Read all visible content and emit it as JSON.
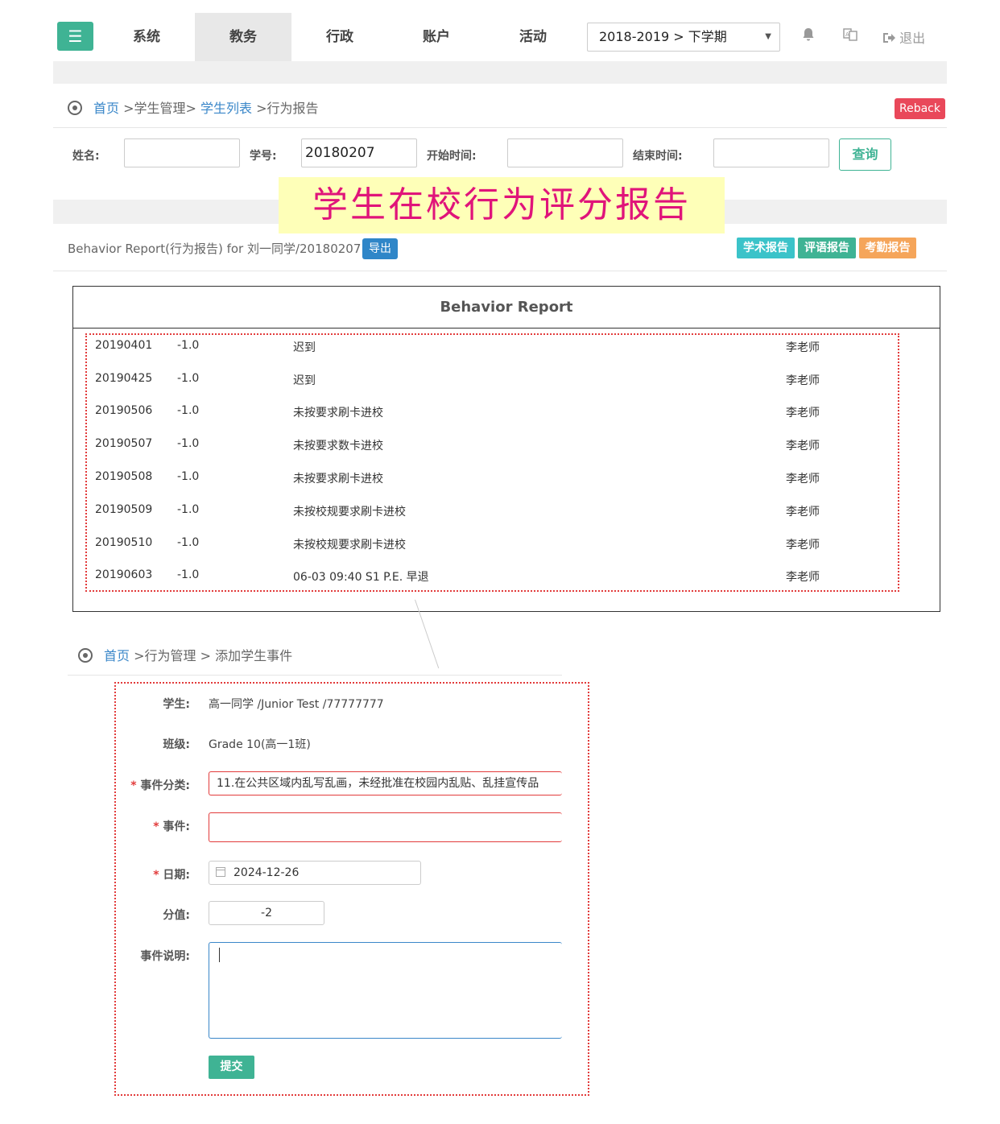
{
  "nav": {
    "menu_icon": "menu-icon",
    "items": [
      {
        "label": "系统"
      },
      {
        "label": "教务"
      },
      {
        "label": "行政"
      },
      {
        "label": "账户"
      },
      {
        "label": "活动"
      }
    ],
    "active_index": 1,
    "term": "2018-2019 > 下学期",
    "icons": [
      "bell-icon",
      "translate-icon",
      "logout-icon"
    ],
    "logout_label": "退出"
  },
  "breadcrumb1": {
    "home": "首页",
    "sep1": " >学生管理> ",
    "list": "学生列表",
    "sep2": " >行为报告"
  },
  "reback_label": "Reback",
  "search": {
    "name_label": "姓名:",
    "name_value": "",
    "id_label": "学号:",
    "id_value": "20180207",
    "start_label": "开始时间:",
    "start_value": "",
    "end_label": "结束时间:",
    "end_value": "",
    "query_label": "查询"
  },
  "banner": "学生在校行为评分报告",
  "report": {
    "title": "Behavior Report(行为报告) for 刘一同学/20180207",
    "export_label": "导出",
    "tags": [
      "学术报告",
      "评语报告",
      "考勤报告"
    ],
    "tag_colors": [
      "#3bc3c9",
      "#3fb394",
      "#f5a55a"
    ],
    "heading": "Behavior Report",
    "rows": [
      {
        "date": "20190401",
        "score": "-1.0",
        "event": "迟到",
        "teacher": "李老师"
      },
      {
        "date": "20190425",
        "score": "-1.0",
        "event": "迟到",
        "teacher": "李老师"
      },
      {
        "date": "20190506",
        "score": "-1.0",
        "event": "未按要求刷卡进校",
        "teacher": "李老师"
      },
      {
        "date": "20190507",
        "score": "-1.0",
        "event": "未按要求数卡进校",
        "teacher": "李老师"
      },
      {
        "date": "20190508",
        "score": "-1.0",
        "event": "未按要求刷卡进校",
        "teacher": "李老师"
      },
      {
        "date": "20190509",
        "score": "-1.0",
        "event": "未按校规要求刷卡进校",
        "teacher": "李老师"
      },
      {
        "date": "20190510",
        "score": "-1.0",
        "event": "未按校规要求刷卡进校",
        "teacher": "李老师"
      },
      {
        "date": "20190603",
        "score": "-1.0",
        "event": "06-03 09:40  S1 P.E.  早退",
        "teacher": "李老师"
      }
    ]
  },
  "breadcrumb2": {
    "home": "首页",
    "rest": " >行为管理 > 添加学生事件"
  },
  "form": {
    "student_label": "学生:",
    "student_value": "高一同学 /Junior Test /77777777",
    "class_label": "班级:",
    "class_value": "Grade 10(高一1班)",
    "category_label": "事件分类:",
    "category_value": "11.在公共区域内乱写乱画，未经批准在校园内乱贴、乱挂宣传品",
    "event_label": "事件:",
    "event_value": "",
    "date_label": "日期:",
    "date_value": "2024-12-26",
    "score_label": "分值:",
    "score_value": "-2",
    "desc_label": "事件说明:",
    "desc_value": "",
    "required_mark": "*",
    "submit_label": "提交"
  }
}
